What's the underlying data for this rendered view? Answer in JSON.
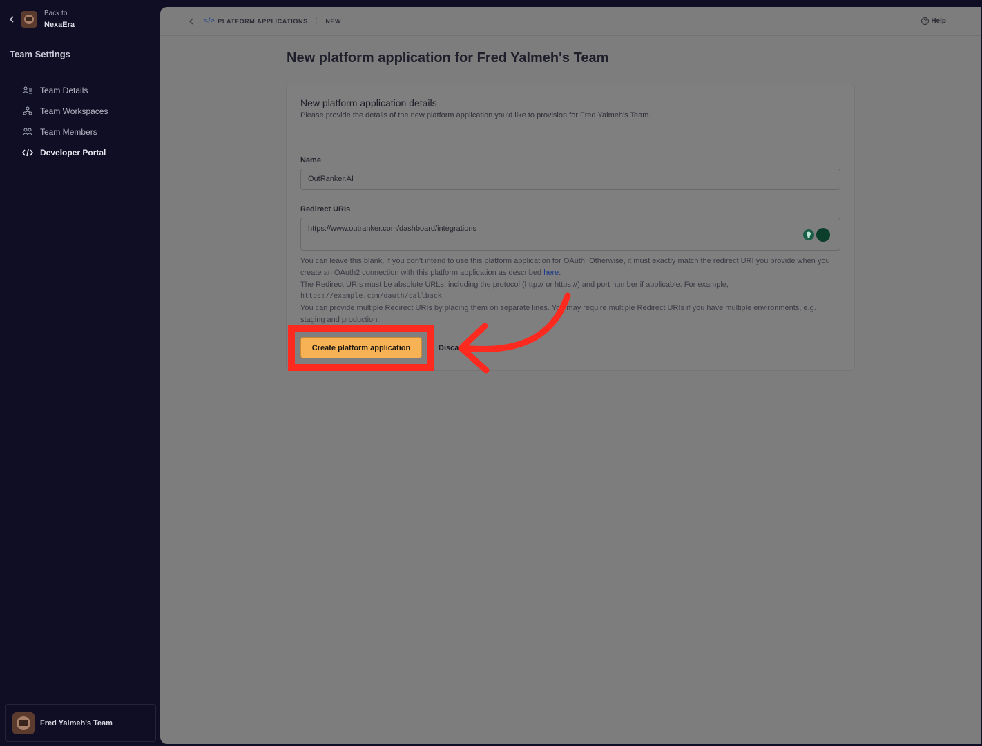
{
  "sidebar": {
    "back_label": "Back to",
    "back_name": "NexaEra",
    "section_title": "Team Settings",
    "items": [
      {
        "label": "Team Details",
        "icon": "team-details-icon",
        "active": false
      },
      {
        "label": "Team Workspaces",
        "icon": "workspaces-icon",
        "active": false
      },
      {
        "label": "Team Members",
        "icon": "members-icon",
        "active": false
      },
      {
        "label": "Developer Portal",
        "icon": "code-icon",
        "active": true
      }
    ],
    "team_name": "Fred Yalmeh's Team"
  },
  "topbar": {
    "breadcrumb": [
      "PLATFORM APPLICATIONS",
      "NEW"
    ],
    "help_label": "Help"
  },
  "page": {
    "title": "New platform application for Fred Yalmeh's Team"
  },
  "form": {
    "title": "New platform application details",
    "subtitle": "Please provide the details of the new platform application you'd like to provision for Fred Yalmeh's Team.",
    "name_label": "Name",
    "name_value": "OutRanker.AI",
    "uri_label": "Redirect URIs",
    "uri_value": "https://www.outranker.com/dashboard/integrations",
    "help_p1": "You can leave this blank, if you don't intend to use this platform application for OAuth. Otherwise, it must exactly match the redirect URI you provide when you create an OAuth2 connection with this platform application as described ",
    "help_link": "here",
    "help_p1_end": ".",
    "help_p2": "The Redirect URIs must be absolute URLs, including the protocol (http:// or https://) and port number if applicable. For example,",
    "help_example": "https://example.com/oauth/callback",
    "help_p3": "You can provide multiple Redirect URIs by placing them on separate lines. You may require multiple Redirect URIs if you have multiple environments, e.g. staging and production.",
    "create_label": "Create platform application",
    "discard_label": "Discard"
  },
  "colors": {
    "sidebar_bg": "#0f0e24",
    "primary_button": "#f8b256",
    "annotation": "#ff2a1f"
  }
}
